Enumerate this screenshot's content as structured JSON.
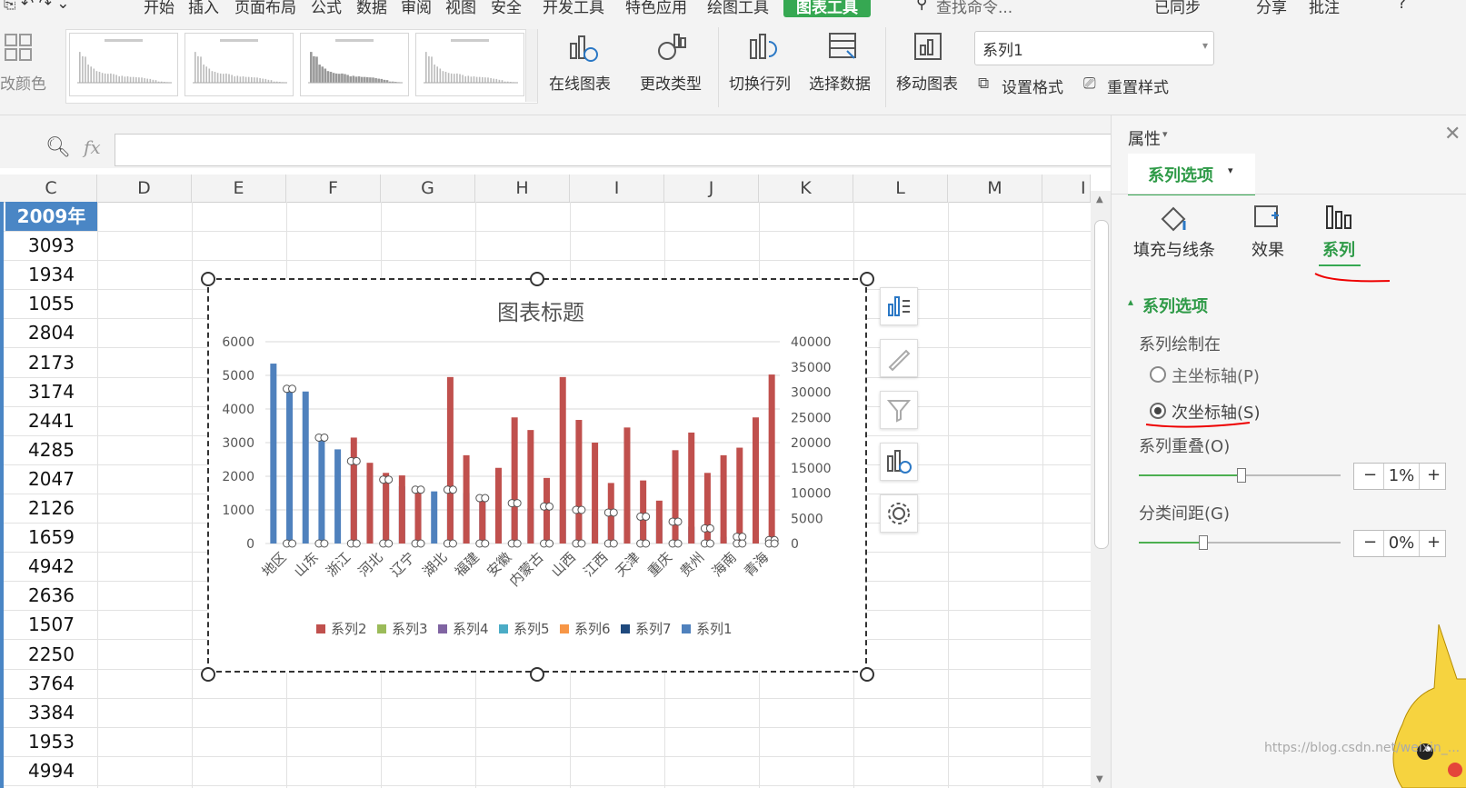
{
  "menu": {
    "items": [
      "开始",
      "插入",
      "页面布局",
      "公式",
      "数据",
      "审阅",
      "视图",
      "安全",
      "开发工具",
      "特色应用",
      "绘图工具",
      "图表工具"
    ],
    "active": "图表工具",
    "search": "查找命令...",
    "sync": "已同步",
    "share": "分享",
    "comment": "批注"
  },
  "ribbon": {
    "change_color": "改颜色",
    "online_chart": "在线图表",
    "change_type": "更改类型",
    "switch_rowcol": "切换行列",
    "select_data": "选择数据",
    "move_chart": "移动图表",
    "series_select": "系列1",
    "set_format": "设置格式",
    "reset_style": "重置样式"
  },
  "formula": {
    "fx": "fx",
    "value": ""
  },
  "columns": [
    "C",
    "D",
    "E",
    "F",
    "G",
    "H",
    "I",
    "J",
    "K",
    "L",
    "M",
    "I"
  ],
  "cells_c": [
    "2009年",
    "3093",
    "1934",
    "1055",
    "2804",
    "2173",
    "3174",
    "2441",
    "4285",
    "2047",
    "2126",
    "1659",
    "4942",
    "2636",
    "1507",
    "2250",
    "3764",
    "3384",
    "1953",
    "4994"
  ],
  "chart_data": {
    "type": "bar",
    "title": "图表标题",
    "categories": [
      "地区",
      "山东",
      "浙江",
      "河北",
      "辽宁",
      "湖北",
      "福建",
      "安徽",
      "内蒙古",
      "山西",
      "江西",
      "天津",
      "重庆",
      "贵州",
      "海南",
      "青海"
    ],
    "primary_axis": {
      "ticks": [
        "0",
        "1000",
        "2000",
        "3000",
        "4000",
        "5000",
        "6000"
      ],
      "ylim": [
        0,
        6000
      ]
    },
    "secondary_axis": {
      "ticks": [
        "0",
        "5000",
        "10000",
        "15000",
        "20000",
        "25000",
        "30000",
        "35000",
        "40000"
      ],
      "ylim": [
        0,
        40000
      ]
    },
    "series": [
      {
        "name": "系列1",
        "axis": "primary",
        "color": "#4f81bd",
        "values": [
          5350,
          4600,
          4520,
          3150,
          2800,
          2450,
          2020,
          1900,
          1700,
          1600,
          1550,
          1600,
          1500,
          1350,
          1100,
          1200,
          1050,
          1100,
          1000,
          1000,
          950,
          920,
          900,
          800,
          700,
          650,
          500,
          450,
          200,
          200,
          150,
          100
        ]
      },
      {
        "name": "系列2",
        "axis": "secondary",
        "color": "#c0504d",
        "values": [
          0,
          0,
          0,
          0,
          0,
          21000,
          16000,
          14000,
          13500,
          11000,
          0,
          33000,
          17500,
          9500,
          15000,
          25000,
          22500,
          13000,
          33000,
          24500,
          20000,
          12000,
          23000,
          12500,
          8500,
          18500,
          22000,
          14000,
          17500,
          19000,
          25000,
          33500
        ]
      }
    ],
    "legend": [
      "系列2",
      "系列3",
      "系列4",
      "系列5",
      "系列6",
      "系列7",
      "系列1"
    ],
    "legend_colors": [
      "#c0504d",
      "#9bbb59",
      "#8064a2",
      "#4bacc6",
      "#f79646",
      "#1f497d",
      "#4f81bd"
    ]
  },
  "panel": {
    "title": "属性",
    "tab": "系列选项",
    "sub_fill": "填充与线条",
    "sub_effect": "效果",
    "sub_series": "系列",
    "section": "系列选项",
    "plot_on": "系列绘制在",
    "primary_axis": "主坐标轴(P)",
    "secondary_axis": "次坐标轴(S)",
    "overlap": "系列重叠(O)",
    "overlap_value": "1%",
    "gap": "分类间距(G)",
    "gap_value": "0%",
    "watermark": "https://blog.csdn.net/weixin_..."
  }
}
